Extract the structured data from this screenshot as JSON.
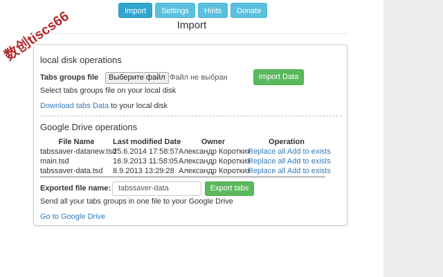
{
  "nav": {
    "tabs": [
      "Import",
      "Settings",
      "Hints",
      "Donate"
    ],
    "active_index": 0
  },
  "page": {
    "title": "Import"
  },
  "local": {
    "title": "local disk operations",
    "tabs_groups_label": "Tabs groups file",
    "choose_file_button": "Выберите файл",
    "file_status": "Файл не выбран",
    "import_button": "Import Data",
    "hint": "Select tabs groups file on your local disk",
    "download_link": "Download tabs Data",
    "download_suffix": " to your local disk"
  },
  "drive": {
    "title": "Google Drive operations",
    "columns": [
      "File Name",
      "Last modified Date",
      "Owner",
      "Operation"
    ],
    "rows": [
      {
        "file": "tabssaver-datanew.tsd",
        "modified": "25.6.2014 17:58:57",
        "owner": "Александр Коротких",
        "replace": "Replace all",
        "add": "Add to exists"
      },
      {
        "file": "main.tsd",
        "modified": "16.9.2013 11:58:05",
        "owner": "Александр Коротких",
        "replace": "Replace all",
        "add": "Add to exists"
      },
      {
        "file": "tabssaver-data.tsd",
        "modified": "8.9.2013 13:29:28",
        "owner": "Александр Коротких",
        "replace": "Replace all",
        "add": "Add to exists"
      }
    ],
    "export_label": "Exported file name:",
    "export_value": "tabssaver-data",
    "export_button": "Export tabs",
    "export_hint": "Send all your tabs groups in one file to your Google Drive",
    "go_link": "Go to Google Drive"
  },
  "watermark": {
    "text": "数创tiscs66"
  },
  "colors": {
    "info_button": "#5bc0de",
    "success_button": "#5cb85c",
    "link": "#337ab7",
    "watermark": "#b11f1f"
  }
}
